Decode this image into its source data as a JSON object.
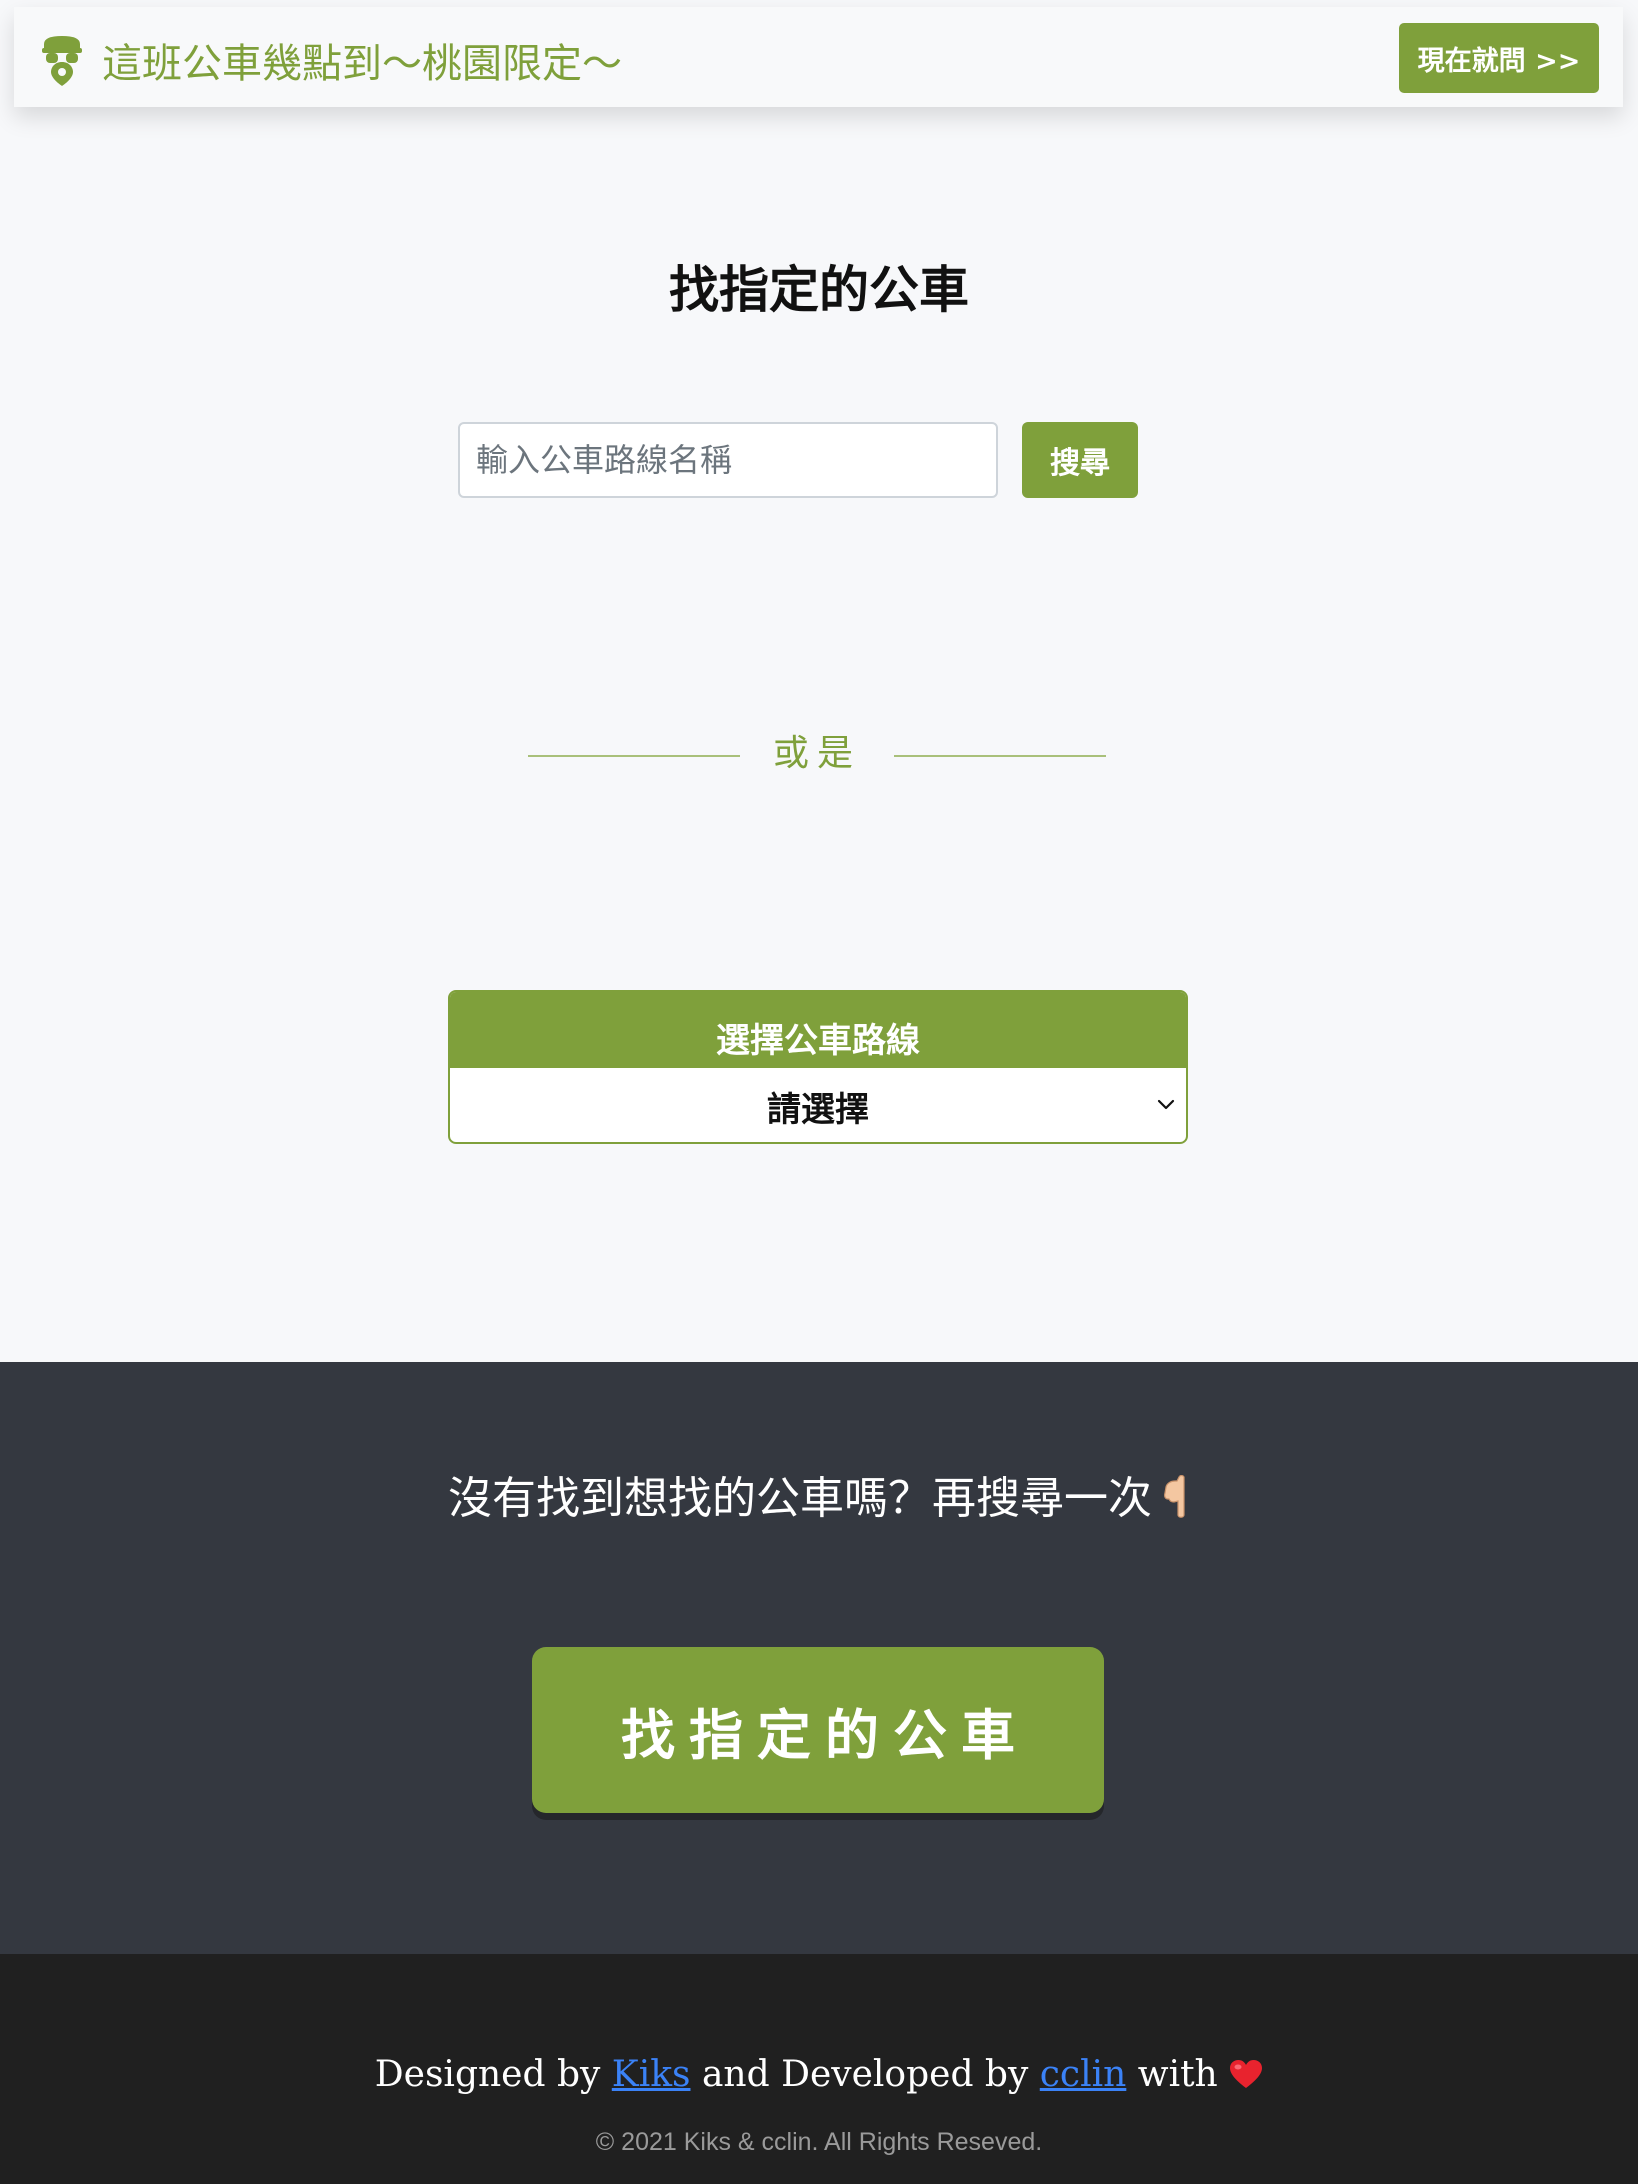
{
  "navbar": {
    "brand_icon": "bus-stop-pin-icon",
    "title": "這班公車幾點到～桃園限定～",
    "ask_button": "現在就問 >>"
  },
  "search": {
    "title": "找指定的公車",
    "placeholder": "輸入公車路線名稱",
    "value": "",
    "button": "搜尋"
  },
  "divider": {
    "text": "或是"
  },
  "route_select": {
    "header": "選擇公車路線",
    "selected": "請選擇"
  },
  "cta": {
    "text": "沒有找到想找的公車嗎？再搜尋一次",
    "emoji_icon": "pointing-down-hand-icon",
    "button": "找指定的公車"
  },
  "footer": {
    "designed_by": "Designed by",
    "designer": "Kiks",
    "developed_by": "and Developed by",
    "developer": "cclin",
    "with": "with",
    "heart_icon": "red-heart-icon",
    "copyright": "© 2021 Kiks & cclin. All Rights Reseved."
  },
  "colors": {
    "brand": "#7fa03b",
    "background": "#f7f8fa",
    "cta_background": "#343840",
    "footer_background": "#202020",
    "link": "#3b82f6"
  }
}
